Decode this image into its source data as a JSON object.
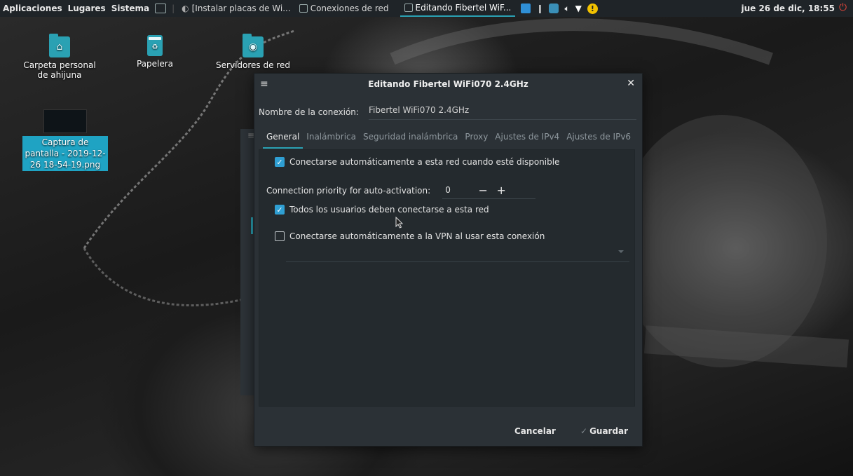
{
  "top_panel": {
    "menus": [
      "Aplicaciones",
      "Lugares",
      "Sistema"
    ],
    "tasks": [
      {
        "label": "[Instalar placas de Wi..."
      },
      {
        "label": "Conexiones de red"
      },
      {
        "label": "Editando Fibertel WiF..."
      }
    ],
    "tray_icons": [
      "app-grid-icon",
      "flag-icon",
      "network-manager-icon",
      "volume-icon",
      "wifi-icon",
      "warning-icon"
    ],
    "clock": "jue 26 de dic, 18:55"
  },
  "desktop": {
    "icons": [
      {
        "label": "Carpeta personal de ahijuna"
      },
      {
        "label": "Papelera"
      },
      {
        "label": "Servidores de red"
      },
      {
        "label": "Captura de pantalla - 2019-12-26 18-54-19.png"
      }
    ]
  },
  "dialog": {
    "title": "Editando Fibertel WiFi070 2.4GHz",
    "connection_name_label": "Nombre de la conexión:",
    "connection_name_value": "Fibertel WiFi070 2.4GHz",
    "tabs": [
      {
        "label": "General",
        "active": true
      },
      {
        "label": "Inalámbrica"
      },
      {
        "label": "Seguridad inalámbrica"
      },
      {
        "label": "Proxy"
      },
      {
        "label": "Ajustes de IPv4"
      },
      {
        "label": "Ajustes de IPv6"
      }
    ],
    "general": {
      "auto_connect": {
        "label": "Conectarse automáticamente a esta red cuando esté disponible",
        "checked": true
      },
      "priority_label": "Connection priority for auto-activation:",
      "priority_value": "0",
      "minus": "−",
      "plus": "+",
      "all_users": {
        "label": "Todos los usuarios deben conectarse a esta red",
        "checked": true
      },
      "vpn_auto": {
        "label": "Conectarse automáticamente a la VPN al usar esta conexión",
        "checked": false
      }
    },
    "buttons": {
      "cancel": "Cancelar",
      "save": "Guardar"
    }
  },
  "colors": {
    "accent": "#2aa1b3",
    "checkbox": "#2f9fd3",
    "dialog_bg": "#2b3136",
    "panel_bg": "#1f2428"
  }
}
